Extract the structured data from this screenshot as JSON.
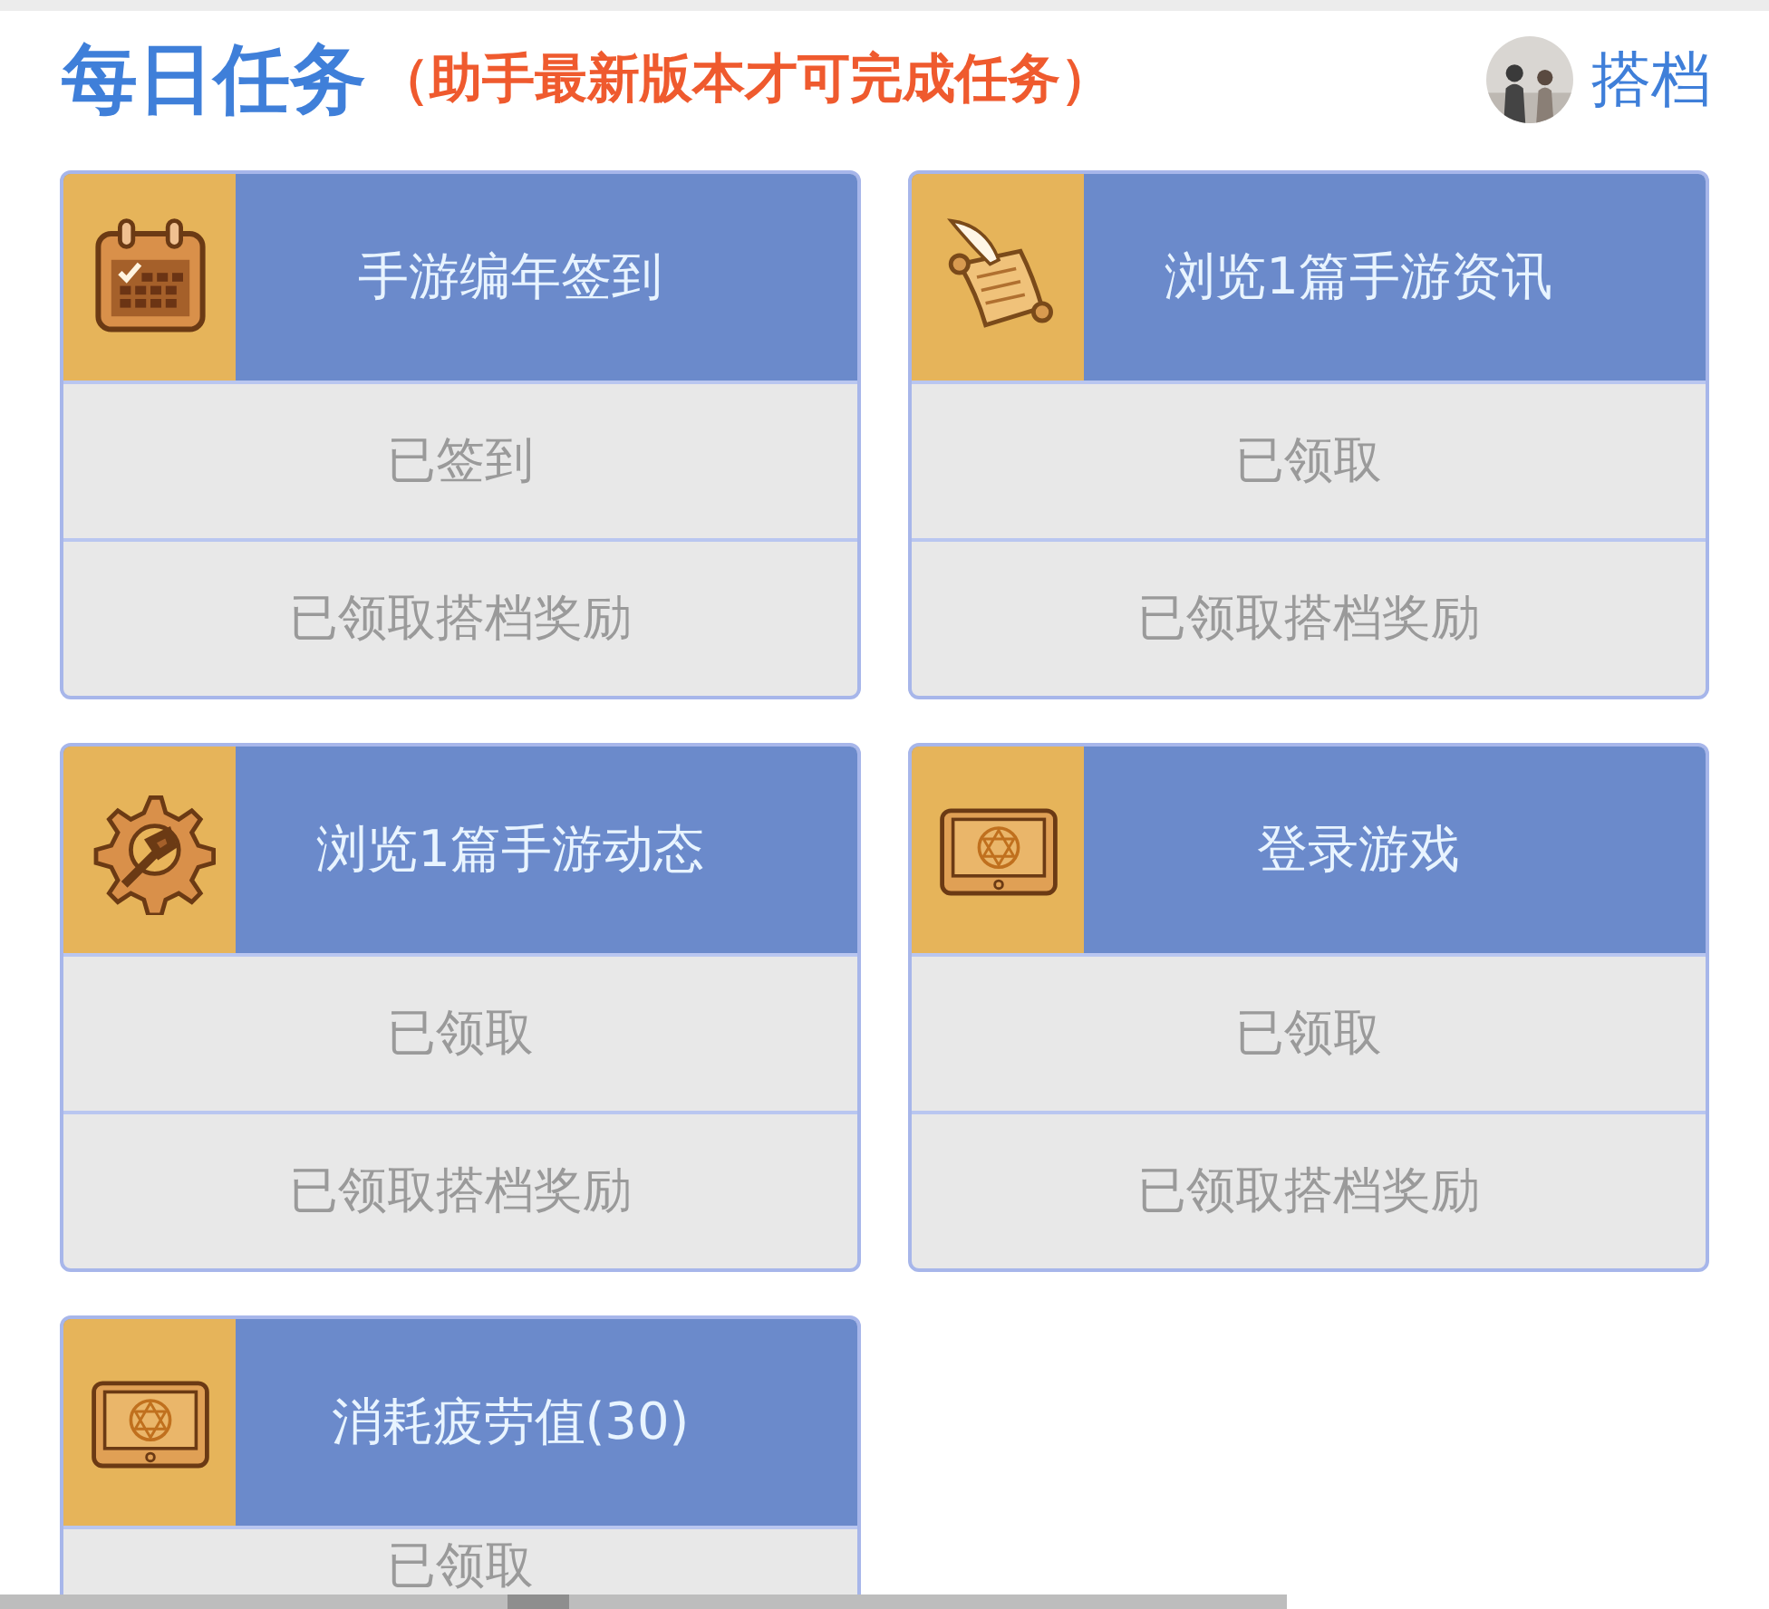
{
  "header": {
    "title": "每日任务",
    "notice": "（助手最新版本才可完成任务）",
    "partner_link": "搭档"
  },
  "tasks": [
    {
      "title": "手游编年签到",
      "rows": [
        "已签到",
        "已领取搭档奖励"
      ]
    },
    {
      "title": "浏览1篇手游资讯",
      "rows": [
        "已领取",
        "已领取搭档奖励"
      ]
    },
    {
      "title": "浏览1篇手游动态",
      "rows": [
        "已领取",
        "已领取搭档奖励"
      ]
    },
    {
      "title": "登录游戏",
      "rows": [
        "已领取",
        "已领取搭档奖励"
      ]
    },
    {
      "title": "消耗疲劳值(30)",
      "rows": [
        "已领取"
      ]
    }
  ]
}
